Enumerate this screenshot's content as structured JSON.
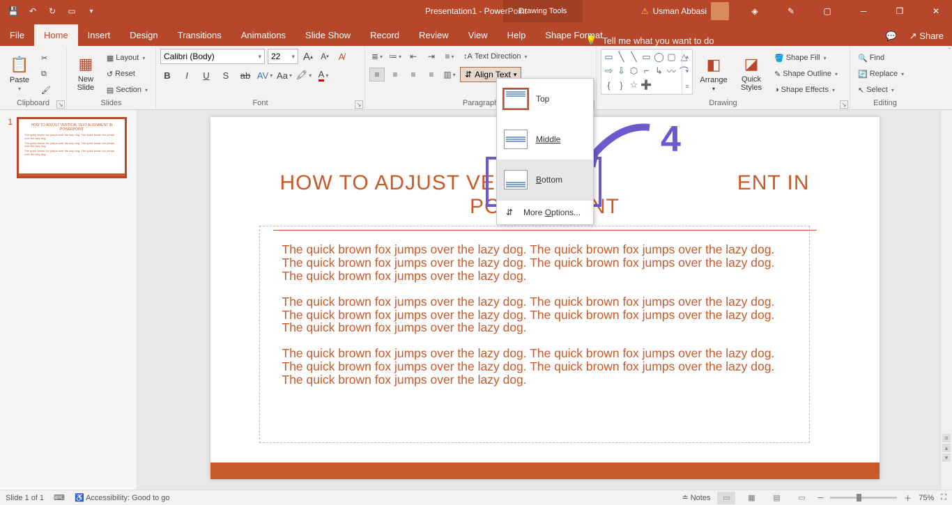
{
  "title": "Presentation1  -  PowerPoint",
  "context_tab": "Drawing Tools",
  "user": "Usman Abbasi",
  "tabs": [
    "File",
    "Home",
    "Insert",
    "Design",
    "Transitions",
    "Animations",
    "Slide Show",
    "Record",
    "Review",
    "View",
    "Help",
    "Shape Format"
  ],
  "tellme": "Tell me what you want to do",
  "share": "Share",
  "groups": {
    "clipboard": "Clipboard",
    "slides": "Slides",
    "font": "Font",
    "paragraph": "Paragraph",
    "drawing": "Drawing",
    "editing": "Editing"
  },
  "clipboard": {
    "paste": "Paste"
  },
  "slides": {
    "new": "New\nSlide",
    "layout": "Layout",
    "reset": "Reset",
    "section": "Section"
  },
  "font": {
    "name": "Calibri (Body)",
    "size": "22"
  },
  "paragraph": {
    "text_direction": "Text Direction",
    "align_text": "Align Text",
    "smartart": ""
  },
  "dropdown": {
    "top": "Top",
    "middle": "Middle",
    "bottom": "Bottom",
    "more": "More Options..."
  },
  "drawing": {
    "arrange": "Arrange",
    "quick": "Quick\nStyles",
    "fill": "Shape Fill",
    "outline": "Shape Outline",
    "effects": "Shape Effects"
  },
  "editing": {
    "find": "Find",
    "replace": "Replace",
    "select": "Select"
  },
  "annotation_number": "4",
  "slide": {
    "title": "HOW TO  ADJUST VERTICAL TEXT ALIGNMENT IN POWERPOINT",
    "title_masked_a": "HOW TO  ADJUST VERTICAL T",
    "title_masked_b": "ENT IN POWERPOINT",
    "para": "The quick brown fox jumps over the lazy dog. The quick brown fox jumps over the lazy dog. The quick brown fox jumps over the lazy dog. The quick brown fox jumps over the lazy dog. The quick brown fox jumps over the lazy dog."
  },
  "thumb_num": "1",
  "status": {
    "slide": "Slide 1 of 1",
    "access": "Accessibility: Good to go",
    "notes": "Notes",
    "zoom": "75%"
  }
}
